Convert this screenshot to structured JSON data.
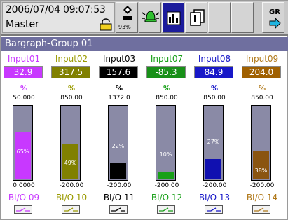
{
  "header": {
    "date": "2006/07/04",
    "time": "09:07:53",
    "user": "Master",
    "memory_label": "93%",
    "gr_label": "GR"
  },
  "group": {
    "title": "Bargraph-Group 01"
  },
  "channels": [
    {
      "name": "Input01",
      "value": "32.9",
      "unit": "%",
      "top": "50.000",
      "bottom": "0.0000",
      "percent_label": "65%",
      "level": 0.65,
      "bio": "BI/O 09",
      "color": "#c838ff",
      "value_bg": "#c838ff",
      "fill": "#c838ff"
    },
    {
      "name": "Input02",
      "value": "317.5",
      "unit": "%",
      "top": "850.00",
      "bottom": "-200.00",
      "percent_label": "49%",
      "level": 0.49,
      "bio": "BI/O 10",
      "color": "#9a9a00",
      "value_bg": "#808000",
      "fill": "#808000"
    },
    {
      "name": "Input03",
      "value": "157.6",
      "unit": "%",
      "top": "1372.0",
      "bottom": "-200.00",
      "percent_label": "22%",
      "level": 0.22,
      "bio": "BI/O 11",
      "color": "#000000",
      "value_bg": "#000000",
      "fill": "#000000"
    },
    {
      "name": "Input07",
      "value": "-85.3",
      "unit": "%",
      "top": "850.00",
      "bottom": "-200.00",
      "percent_label": "10%",
      "level": 0.1,
      "bio": "BI/O 12",
      "color": "#18a018",
      "value_bg": "#189018",
      "fill": "#18a018"
    },
    {
      "name": "Input08",
      "value": "84.9",
      "unit": "%",
      "top": "850.00",
      "bottom": "-200.00",
      "percent_label": "27%",
      "level": 0.27,
      "bio": "BI/O 13",
      "color": "#1818c8",
      "value_bg": "#1818c8",
      "fill": "#1010b0"
    },
    {
      "name": "Input09",
      "value": "204.0",
      "unit": "%",
      "top": "850.00",
      "bottom": "-200.00",
      "percent_label": "38%",
      "level": 0.38,
      "bio": "BI/O 14",
      "color": "#b07818",
      "value_bg": "#a06000",
      "fill": "#8a5410"
    }
  ],
  "icons": {
    "lock": "lock-icon",
    "memory": "memory-card-icon",
    "alarm": "alarm-bell-icon",
    "display_mode": "display-mode-icon",
    "copy": "copy-pages-icon",
    "switch": "gr-switch-icon",
    "relay": "relay-switch-icon"
  }
}
